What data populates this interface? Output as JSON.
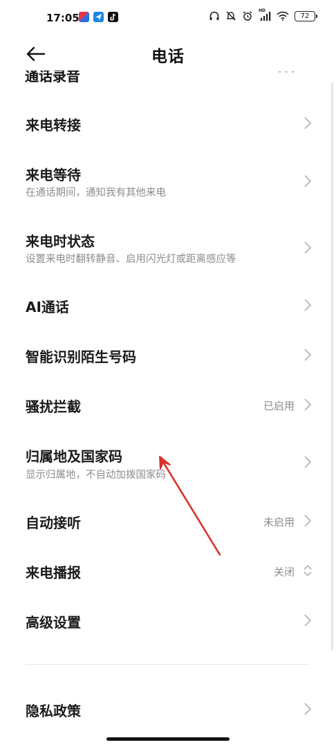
{
  "status": {
    "time": "17:05",
    "battery": "72",
    "hd_label": "HD"
  },
  "appbar": {
    "title": "电话"
  },
  "clipped_row": {
    "title": "通话录音",
    "value": "- - -"
  },
  "rows": [
    {
      "title": "来电转接",
      "subtitle": "",
      "value": ""
    },
    {
      "title": "来电等待",
      "subtitle": "在通话期间，通知我有其他来电",
      "value": ""
    },
    {
      "title": "来电时状态",
      "subtitle": "设置来电时翻转静音、启用闪光灯或距离感应等",
      "value": ""
    },
    {
      "title": "AI通话",
      "subtitle": "",
      "value": ""
    },
    {
      "title": "智能识别陌生号码",
      "subtitle": "",
      "value": ""
    },
    {
      "title": "骚扰拦截",
      "subtitle": "",
      "value": "已启用"
    },
    {
      "title": "归属地及国家码",
      "subtitle": "显示归属地，不自动加拨国家码",
      "value": ""
    },
    {
      "title": "自动接听",
      "subtitle": "",
      "value": "未启用"
    },
    {
      "title": "来电播报",
      "subtitle": "",
      "value": "关闭"
    },
    {
      "title": "高级设置",
      "subtitle": "",
      "value": ""
    },
    {
      "title": "隐私政策",
      "subtitle": "",
      "value": ""
    }
  ],
  "colors": {
    "annotation_arrow": "#d8322a",
    "app_icon_1": "#e5344d",
    "app_icon_2": "#1e88e5",
    "app_icon_3": "#111111"
  }
}
